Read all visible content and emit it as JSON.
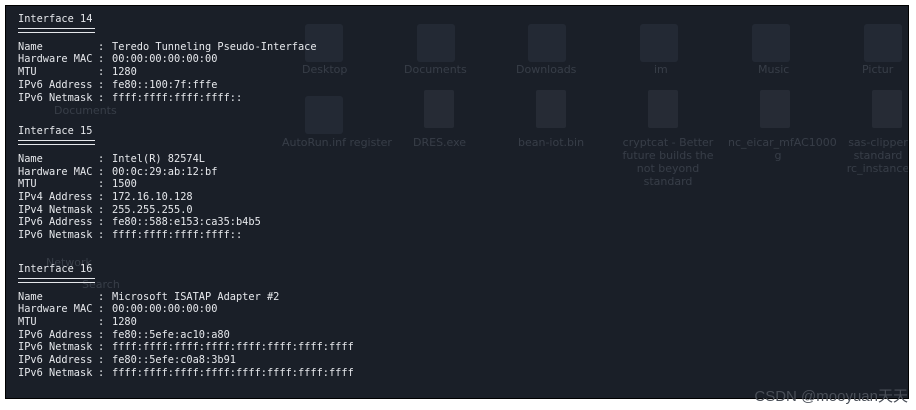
{
  "background_labels": {
    "desktop": "Desktop",
    "documents": "Documents",
    "downloads": "Downloads",
    "im": "im",
    "music": "Music",
    "pictures": "Pictur",
    "documents_sidebar": "Documents",
    "file1": "DRES.exe",
    "file2": "bean-iot.bin",
    "file3": "cryptcat - Better\nfuture builds the\nnot beyond\nstandard",
    "file4": "nc_eicar_mfAC1000\ng",
    "file5": "sas-clipper\nstandard\nrc_instance",
    "network": "Network",
    "search": "Search",
    "admin": "AutoRun.inf register"
  },
  "interfaces": [
    {
      "title": "Interface 14",
      "rows": [
        {
          "key": "Name",
          "value": "Teredo Tunneling Pseudo-Interface"
        },
        {
          "key": "Hardware MAC",
          "value": "00:00:00:00:00:00"
        },
        {
          "key": "MTU",
          "value": "1280"
        },
        {
          "key": "IPv6 Address",
          "value": "fe80::100:7f:fffe"
        },
        {
          "key": "IPv6 Netmask",
          "value": "ffff:ffff:ffff:ffff::"
        }
      ]
    },
    {
      "title": "Interface 15",
      "rows": [
        {
          "key": "Name",
          "value": "Intel(R) 82574L"
        },
        {
          "key": "Hardware MAC",
          "value": "00:0c:29:ab:12:bf"
        },
        {
          "key": "MTU",
          "value": "1500"
        },
        {
          "key": "IPv4 Address",
          "value": "172.16.10.128"
        },
        {
          "key": "IPv4 Netmask",
          "value": "255.255.255.0"
        },
        {
          "key": "IPv6 Address",
          "value": "fe80::588:e153:ca35:b4b5"
        },
        {
          "key": "IPv6 Netmask",
          "value": "ffff:ffff:ffff:ffff::"
        }
      ]
    },
    {
      "title": "Interface 16",
      "rows": [
        {
          "key": "Name",
          "value": "Microsoft ISATAP Adapter #2"
        },
        {
          "key": "Hardware MAC",
          "value": "00:00:00:00:00:00"
        },
        {
          "key": "MTU",
          "value": "1280"
        },
        {
          "key": "IPv6 Address",
          "value": "fe80::5efe:ac10:a80"
        },
        {
          "key": "IPv6 Netmask",
          "value": "ffff:ffff:ffff:ffff:ffff:ffff:ffff:ffff"
        },
        {
          "key": "IPv6 Address",
          "value": "fe80::5efe:c0a8:3b91"
        },
        {
          "key": "IPv6 Netmask",
          "value": "ffff:ffff:ffff:ffff:ffff:ffff:ffff:ffff"
        }
      ]
    }
  ],
  "separator": ":",
  "watermark": "CSDN @mooyuan天天"
}
